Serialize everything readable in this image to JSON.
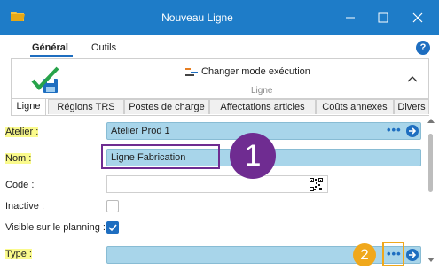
{
  "window": {
    "title": "Nouveau Ligne"
  },
  "ribbon": {
    "tabs": [
      "Général",
      "Outils"
    ],
    "change_mode_label": "Changer mode exécution",
    "group_label": "Ligne"
  },
  "tabs": [
    "Ligne",
    "Régions TRS",
    "Postes de charge",
    "Affectations articles",
    "Coûts annexes",
    "Divers"
  ],
  "form": {
    "atelier": {
      "label": "Atelier :",
      "value": "Atelier Prod 1"
    },
    "nom": {
      "label": "Nom :",
      "value": "Ligne Fabrication"
    },
    "code": {
      "label": "Code :",
      "value": ""
    },
    "inactive": {
      "label": "Inactive :",
      "checked": false
    },
    "visible": {
      "label": "Visible sur le planning :",
      "checked": true
    },
    "type": {
      "label": "Type :",
      "value": ""
    }
  },
  "annotations": {
    "badge1": "1",
    "badge2": "2"
  },
  "colors": {
    "titlebar": "#1e7cc8",
    "combo": "#a8d5ea",
    "accent": "#1e6ec0",
    "annotation1": "#6f2c91",
    "annotation2": "#f0a81c",
    "highlight": "#fafa8c"
  }
}
